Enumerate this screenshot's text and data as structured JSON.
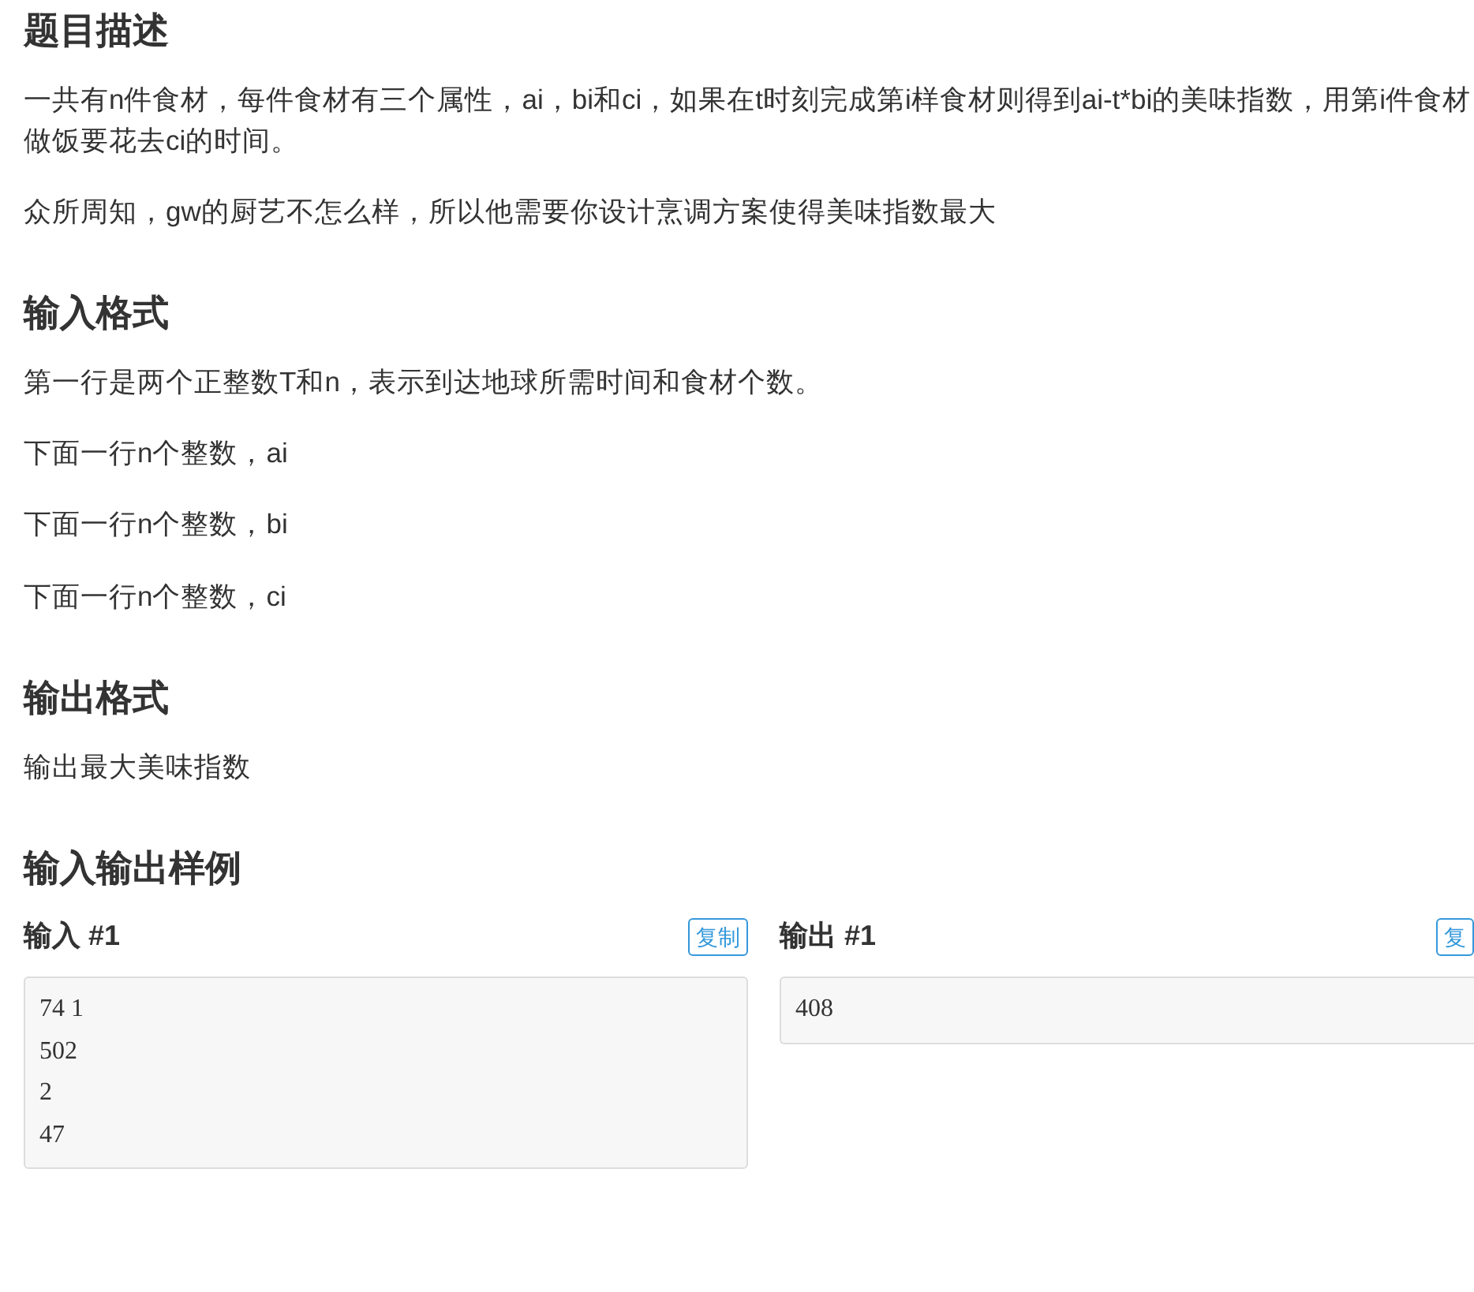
{
  "sections": [
    {
      "title": "题目描述",
      "paragraphs": [
        "一共有n件食材，每件食材有三个属性，ai，bi和ci，如果在t时刻完成第i样食材则得到ai-t*bi的美味指数，用第i件食材做饭要花去ci的时间。",
        "众所周知，gw的厨艺不怎么样，所以他需要你设计烹调方案使得美味指数最大"
      ]
    },
    {
      "title": "输入格式",
      "paragraphs": [
        "第一行是两个正整数T和n，表示到达地球所需时间和食材个数。",
        "下面一行n个整数，ai",
        "下面一行n个整数，bi",
        "下面一行n个整数，ci"
      ]
    },
    {
      "title": "输出格式",
      "paragraphs": [
        "输出最大美味指数"
      ]
    },
    {
      "title": "输入输出样例",
      "samples": [
        {
          "label": "输入 #1",
          "copy_button": "复制",
          "lines": [
            "74 1",
            "502",
            "2",
            "47"
          ]
        },
        {
          "label": "输出 #1",
          "copy_button": "复",
          "lines": [
            "408"
          ]
        }
      ]
    }
  ]
}
